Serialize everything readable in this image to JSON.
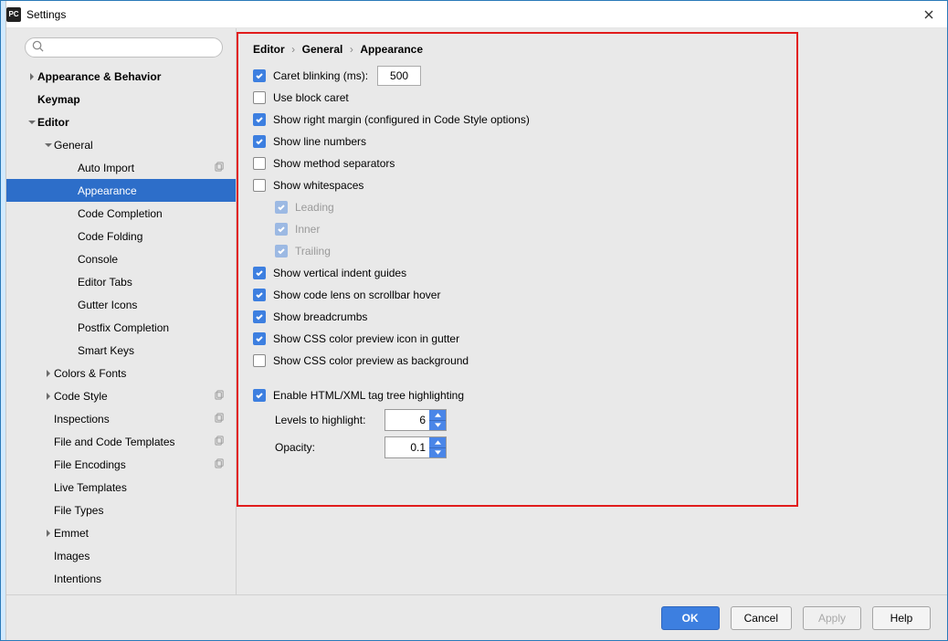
{
  "window": {
    "title": "Settings"
  },
  "search": {
    "placeholder": ""
  },
  "sidebar": {
    "items": [
      {
        "label": "Appearance & Behavior",
        "level": 0,
        "arrow": "right",
        "bold": true,
        "copy": false
      },
      {
        "label": "Keymap",
        "level": 0,
        "arrow": "",
        "bold": true,
        "copy": false
      },
      {
        "label": "Editor",
        "level": 0,
        "arrow": "down",
        "bold": true,
        "copy": false
      },
      {
        "label": "General",
        "level": 1,
        "arrow": "down",
        "bold": false,
        "copy": false
      },
      {
        "label": "Auto Import",
        "level": 2,
        "arrow": "",
        "bold": false,
        "copy": true
      },
      {
        "label": "Appearance",
        "level": 2,
        "arrow": "",
        "bold": false,
        "copy": false,
        "selected": true
      },
      {
        "label": "Code Completion",
        "level": 2,
        "arrow": "",
        "bold": false,
        "copy": false
      },
      {
        "label": "Code Folding",
        "level": 2,
        "arrow": "",
        "bold": false,
        "copy": false
      },
      {
        "label": "Console",
        "level": 2,
        "arrow": "",
        "bold": false,
        "copy": false
      },
      {
        "label": "Editor Tabs",
        "level": 2,
        "arrow": "",
        "bold": false,
        "copy": false
      },
      {
        "label": "Gutter Icons",
        "level": 2,
        "arrow": "",
        "bold": false,
        "copy": false
      },
      {
        "label": "Postfix Completion",
        "level": 2,
        "arrow": "",
        "bold": false,
        "copy": false
      },
      {
        "label": "Smart Keys",
        "level": 2,
        "arrow": "",
        "bold": false,
        "copy": false
      },
      {
        "label": "Colors & Fonts",
        "level": 1,
        "arrow": "right",
        "bold": false,
        "copy": false
      },
      {
        "label": "Code Style",
        "level": 1,
        "arrow": "right",
        "bold": false,
        "copy": true
      },
      {
        "label": "Inspections",
        "level": 1,
        "arrow": "",
        "bold": false,
        "copy": true
      },
      {
        "label": "File and Code Templates",
        "level": 1,
        "arrow": "",
        "bold": false,
        "copy": true
      },
      {
        "label": "File Encodings",
        "level": 1,
        "arrow": "",
        "bold": false,
        "copy": true
      },
      {
        "label": "Live Templates",
        "level": 1,
        "arrow": "",
        "bold": false,
        "copy": false
      },
      {
        "label": "File Types",
        "level": 1,
        "arrow": "",
        "bold": false,
        "copy": false
      },
      {
        "label": "Emmet",
        "level": 1,
        "arrow": "right",
        "bold": false,
        "copy": false
      },
      {
        "label": "Images",
        "level": 1,
        "arrow": "",
        "bold": false,
        "copy": false
      },
      {
        "label": "Intentions",
        "level": 1,
        "arrow": "",
        "bold": false,
        "copy": false
      }
    ]
  },
  "breadcrumb": {
    "p0": "Editor",
    "p1": "General",
    "p2": "Appearance"
  },
  "options": {
    "caret_blinking_label": "Caret blinking (ms):",
    "caret_blinking_value": "500",
    "use_block_caret": "Use block caret",
    "show_right_margin": "Show right margin (configured in Code Style options)",
    "show_line_numbers": "Show line numbers",
    "show_method_separators": "Show method separators",
    "show_whitespaces": "Show whitespaces",
    "ws_leading": "Leading",
    "ws_inner": "Inner",
    "ws_trailing": "Trailing",
    "show_vertical_indent": "Show vertical indent guides",
    "show_code_lens": "Show code lens on scrollbar hover",
    "show_breadcrumbs": "Show breadcrumbs",
    "show_css_gutter": "Show CSS color preview icon in gutter",
    "show_css_background": "Show CSS color preview as background",
    "enable_html_xml": "Enable HTML/XML tag tree highlighting",
    "levels_label": "Levels to highlight:",
    "levels_value": "6",
    "opacity_label": "Opacity:",
    "opacity_value": "0.1"
  },
  "buttons": {
    "ok": "OK",
    "cancel": "Cancel",
    "apply": "Apply",
    "help": "Help"
  }
}
